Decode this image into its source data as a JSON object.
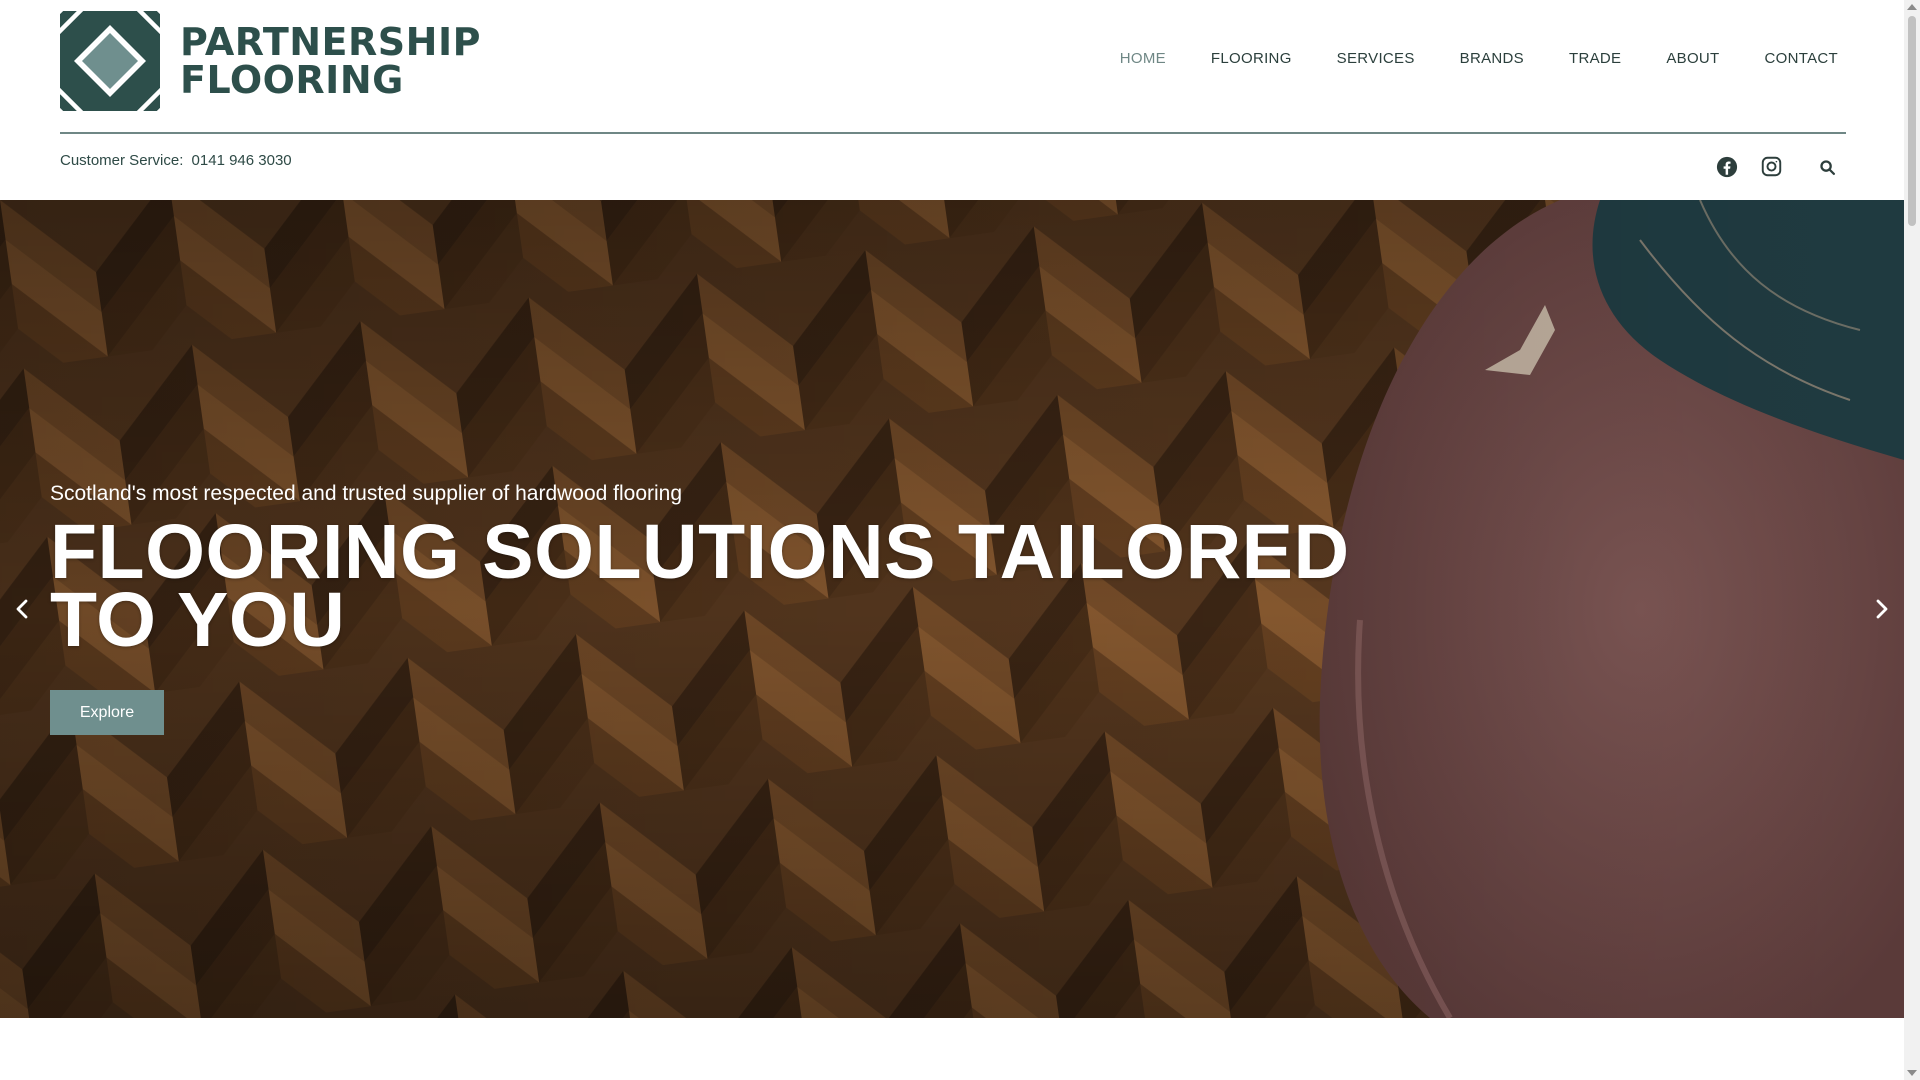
{
  "brand": {
    "name_line1": "PARTNERSHIP",
    "name_line2": "FLOORING",
    "color_primary": "#2d4f4b",
    "color_accent": "#6f8f8e"
  },
  "nav": {
    "items": [
      {
        "label": "HOME",
        "active": true
      },
      {
        "label": "FLOORING",
        "active": false
      },
      {
        "label": "SERVICES",
        "active": false
      },
      {
        "label": "BRANDS",
        "active": false
      },
      {
        "label": "TRADE",
        "active": false
      },
      {
        "label": "ABOUT",
        "active": false
      },
      {
        "label": "CONTACT",
        "active": false
      }
    ]
  },
  "topbar": {
    "customer_service_label": "Customer Service:",
    "phone": "0141 946 3030",
    "icons": [
      "facebook-icon",
      "instagram-icon",
      "search-icon"
    ]
  },
  "hero": {
    "subtitle": "Scotland's most respected and trusted supplier of hardwood flooring",
    "title": "FLOORING SOLUTIONS TAILORED TO YOU",
    "button_label": "Explore",
    "prev_icon": "chevron-left-icon",
    "next_icon": "chevron-right-icon"
  }
}
